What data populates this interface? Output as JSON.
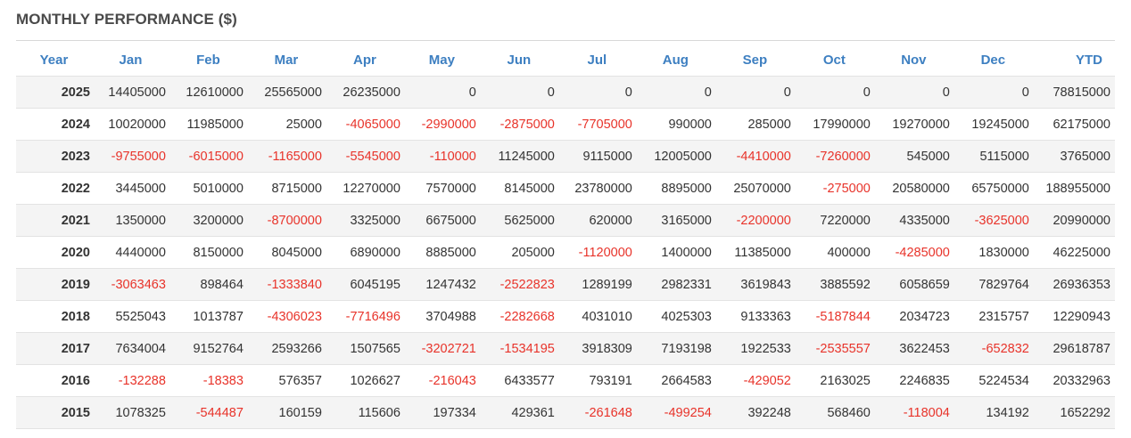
{
  "title": "MONTHLY PERFORMANCE ($)",
  "colors": {
    "header_text": "#3d7fc1",
    "negative": "#e8332a",
    "body_text": "#333333",
    "stripe": "#f4f4f4"
  },
  "headers": [
    "Year",
    "Jan",
    "Feb",
    "Mar",
    "Apr",
    "May",
    "Jun",
    "Jul",
    "Aug",
    "Sep",
    "Oct",
    "Nov",
    "Dec",
    "YTD"
  ],
  "rows": [
    [
      "2025",
      "14405000",
      "12610000",
      "25565000",
      "26235000",
      "0",
      "0",
      "0",
      "0",
      "0",
      "0",
      "0",
      "0",
      "78815000"
    ],
    [
      "2024",
      "10020000",
      "11985000",
      "25000",
      "-4065000",
      "-2990000",
      "-2875000",
      "-7705000",
      "990000",
      "285000",
      "17990000",
      "19270000",
      "19245000",
      "62175000"
    ],
    [
      "2023",
      "-9755000",
      "-6015000",
      "-1165000",
      "-5545000",
      "-110000",
      "11245000",
      "9115000",
      "12005000",
      "-4410000",
      "-7260000",
      "545000",
      "5115000",
      "3765000"
    ],
    [
      "2022",
      "3445000",
      "5010000",
      "8715000",
      "12270000",
      "7570000",
      "8145000",
      "23780000",
      "8895000",
      "25070000",
      "-275000",
      "20580000",
      "65750000",
      "188955000"
    ],
    [
      "2021",
      "1350000",
      "3200000",
      "-8700000",
      "3325000",
      "6675000",
      "5625000",
      "620000",
      "3165000",
      "-2200000",
      "7220000",
      "4335000",
      "-3625000",
      "20990000"
    ],
    [
      "2020",
      "4440000",
      "8150000",
      "8045000",
      "6890000",
      "8885000",
      "205000",
      "-1120000",
      "1400000",
      "11385000",
      "400000",
      "-4285000",
      "1830000",
      "46225000"
    ],
    [
      "2019",
      "-3063463",
      "898464",
      "-1333840",
      "6045195",
      "1247432",
      "-2522823",
      "1289199",
      "2982331",
      "3619843",
      "3885592",
      "6058659",
      "7829764",
      "26936353"
    ],
    [
      "2018",
      "5525043",
      "1013787",
      "-4306023",
      "-7716496",
      "3704988",
      "-2282668",
      "4031010",
      "4025303",
      "9133363",
      "-5187844",
      "2034723",
      "2315757",
      "12290943"
    ],
    [
      "2017",
      "7634004",
      "9152764",
      "2593266",
      "1507565",
      "-3202721",
      "-1534195",
      "3918309",
      "7193198",
      "1922533",
      "-2535557",
      "3622453",
      "-652832",
      "29618787"
    ],
    [
      "2016",
      "-132288",
      "-18383",
      "576357",
      "1026627",
      "-216043",
      "6433577",
      "793191",
      "2664583",
      "-429052",
      "2163025",
      "2246835",
      "5224534",
      "20332963"
    ],
    [
      "2015",
      "1078325",
      "-544487",
      "160159",
      "115606",
      "197334",
      "429361",
      "-261648",
      "-499254",
      "392248",
      "568460",
      "-118004",
      "134192",
      "1652292"
    ]
  ]
}
